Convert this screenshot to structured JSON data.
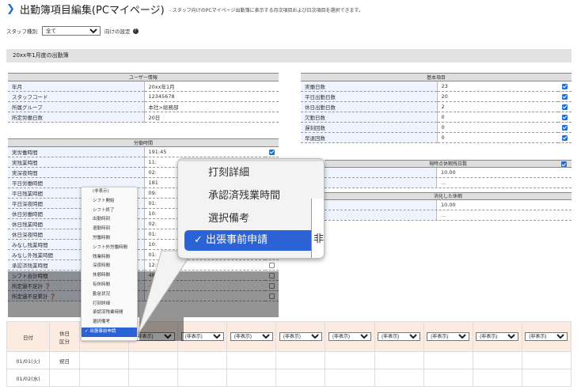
{
  "header": {
    "title": "出勤簿項目編集(PCマイページ)",
    "desc": "- スタッフ向けのPCマイページ出勤簿に表示する月次項目および日次項目を選択できます。"
  },
  "filter": {
    "label": "スタッフ種別",
    "value": "全て",
    "suffix": "向けの設定"
  },
  "banner": "20xx年1月度の出勤簿",
  "user_info": {
    "title": "ユーザー情報",
    "rows": [
      [
        "年月",
        "20xx年1月"
      ],
      [
        "スタッフコード",
        "12345678"
      ],
      [
        "所属グループ",
        "本社>総務部"
      ],
      [
        "所定労働日数",
        "20日"
      ]
    ]
  },
  "basic": {
    "title": "基本項目",
    "rows": [
      [
        "実働日数",
        "23"
      ],
      [
        "平日出勤日数",
        "20"
      ],
      [
        "休日出勤日数",
        "2"
      ],
      [
        "欠勤日数",
        "0"
      ],
      [
        "遅刻回数",
        "0"
      ],
      [
        "早退回数",
        "0"
      ]
    ]
  },
  "labor": {
    "title": "労働時間",
    "rows": [
      [
        "実労働時間",
        "191:45"
      ],
      [
        "実残業時間",
        "11:"
      ],
      [
        "実深夜時間",
        "02:"
      ],
      [
        "平日労働時間",
        "181"
      ],
      [
        "平日残業時間",
        "09:"
      ],
      [
        "平日深夜時間",
        "01:"
      ],
      [
        "休日労働時間",
        "10:"
      ],
      [
        "休日残業時間",
        "02:"
      ],
      [
        "休日深夜時間",
        "01:"
      ],
      [
        "みなし残業時間",
        "10:"
      ],
      [
        "みなし外残業時間",
        "01:"
      ],
      [
        "承認済残業時間",
        "12:00"
      ],
      [
        "シフト合計時間",
        "48:00"
      ],
      [
        "所定過不足計",
        "-168"
      ],
      [
        "所定過不足累計",
        "-16"
      ]
    ]
  },
  "leave": {
    "title": "現時点休暇残日数",
    "value": "10.00",
    "title2": "消化した休暇",
    "value2": "10.00",
    "ellipsis1": "...",
    "ellipsis2": "..."
  },
  "daily": {
    "headers": [
      "日付",
      "休日\n区分"
    ],
    "select_value": "(非表示)",
    "rows": [
      [
        "01/01(火)",
        "祝日"
      ],
      [
        "01/02(水)",
        ""
      ]
    ]
  },
  "menu": {
    "items": [
      "(非表示)",
      "シフト開始",
      "シフト終了",
      "出勤時刻",
      "退勤時刻",
      "労働時間",
      "シフト外労働時間",
      "残業時間",
      "深夜時間",
      "休憩時間",
      "有休時間",
      "勤怠状況",
      "打刻詳細",
      "承認済残業時間",
      "選択備考",
      "出張事前申請"
    ],
    "selected": "出張事前申請"
  },
  "zoom": {
    "items": [
      "打刻詳細",
      "承認済残業時間",
      "選択備考",
      "出張事前申請"
    ],
    "peek": "非"
  },
  "colors": {
    "accent": "#1e6fc8",
    "checkbox": "#1f6fd1",
    "negative": "#e02020",
    "select_highlight": "#2b63d6"
  }
}
